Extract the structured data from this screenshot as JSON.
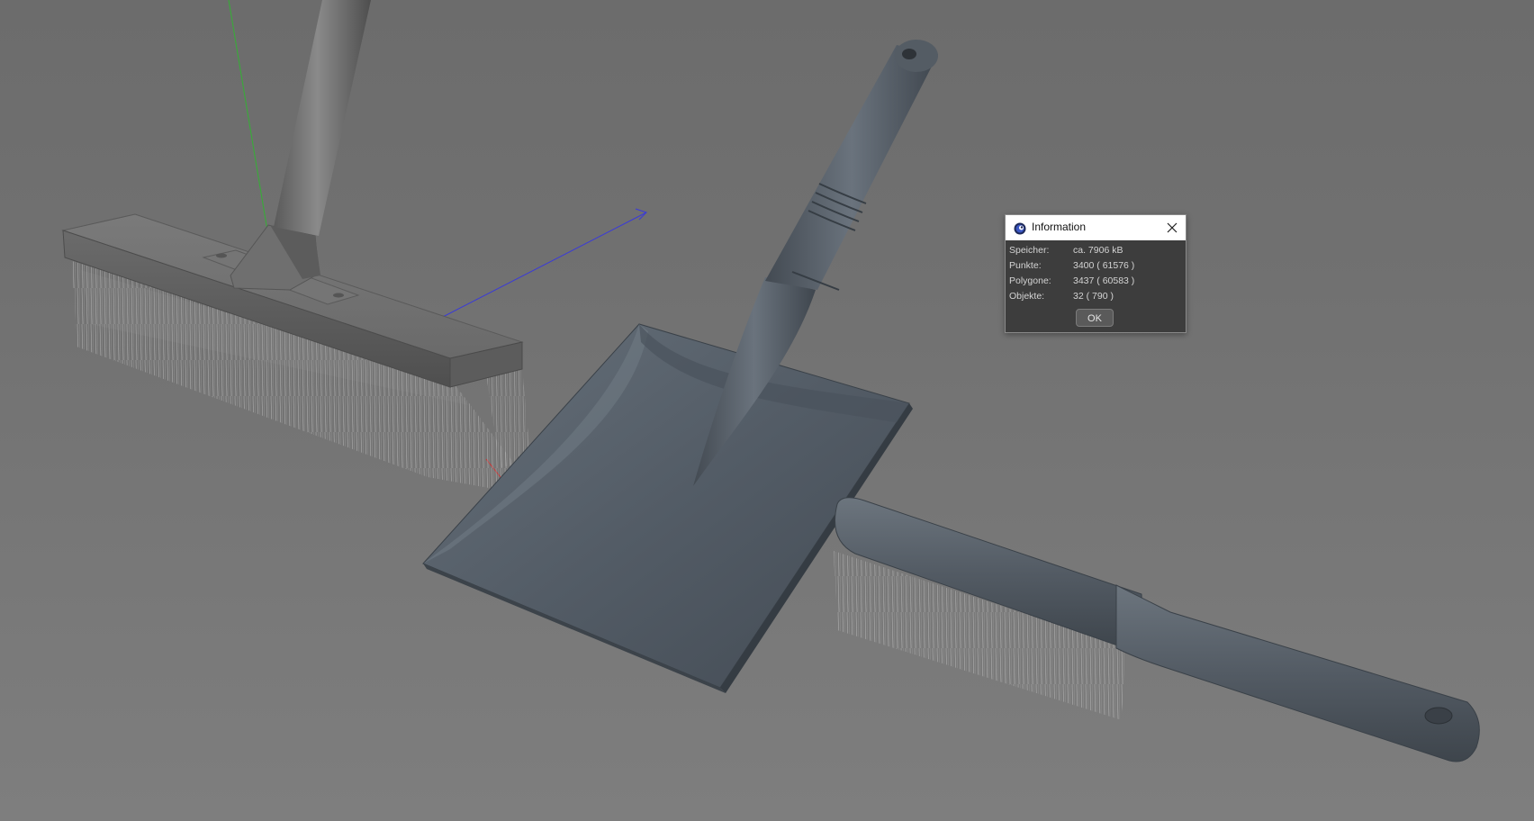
{
  "dialog": {
    "title": "Information",
    "rows": [
      {
        "label": "Speicher:",
        "value": "ca. 7906 kB"
      },
      {
        "label": "Punkte:",
        "value": "3400 ( 61576 )"
      },
      {
        "label": "Polygone:",
        "value": "3437 ( 60583 )"
      },
      {
        "label": "Objekte:",
        "value": "32 ( 790 )"
      }
    ],
    "ok_label": "OK",
    "icons": {
      "app": "cinema4d-logo-icon",
      "close": "close-icon"
    }
  },
  "viewport": {
    "objects": [
      "push-broom",
      "dustpan",
      "hand-brush"
    ],
    "axes": {
      "x_color": "#d03030",
      "y_color": "#34b034",
      "z_color": "#3a3ad8"
    }
  }
}
